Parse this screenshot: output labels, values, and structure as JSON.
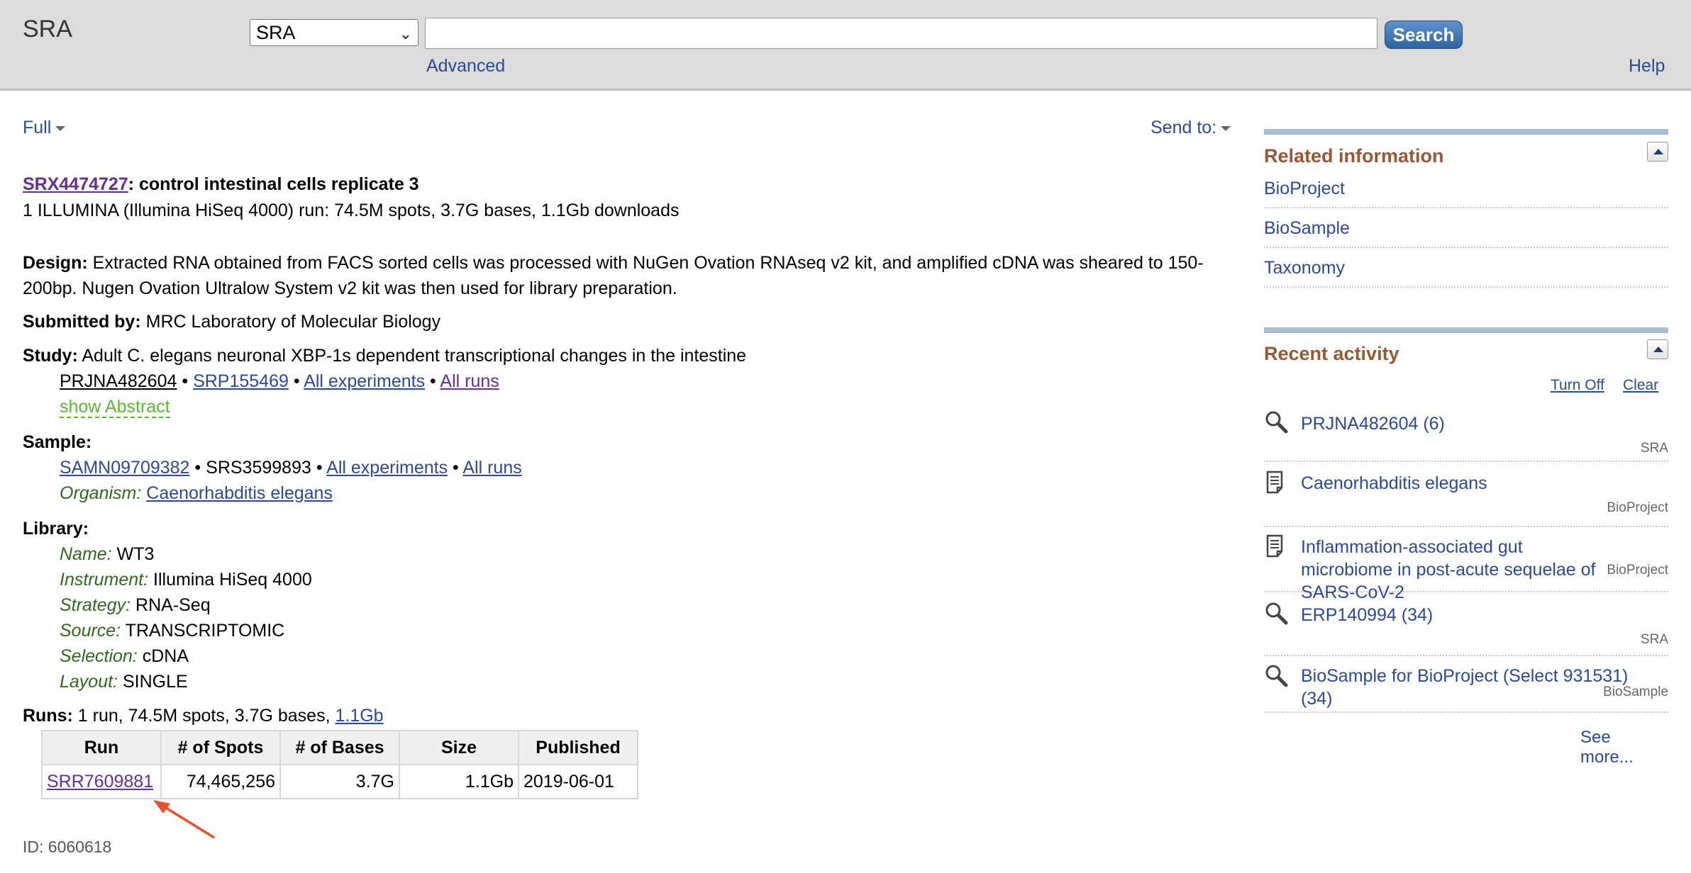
{
  "header": {
    "db_title": "SRA",
    "db_select_value": "SRA",
    "search_value": "",
    "search_label": "Search",
    "advanced": "Advanced",
    "help": "Help"
  },
  "toolbar": {
    "format": "Full",
    "send_to": "Send to:"
  },
  "record": {
    "accession": "SRX4474727",
    "title_rest": ": control intestinal cells replicate 3",
    "summary": "1 ILLUMINA (Illumina HiSeq 4000) run: 74.5M spots, 3.7G bases, 1.1Gb downloads",
    "design_label": "Design:",
    "design_text": "Extracted RNA obtained from FACS sorted cells was processed with NuGen Ovation RNAseq v2 kit, and amplified cDNA was sheared to 150-200bp. Nugen Ovation Ultralow System v2 kit was then used for library preparation.",
    "submitted_label": "Submitted by:",
    "submitted_value": "MRC Laboratory of Molecular Biology",
    "study_label": "Study:",
    "study_value": "Adult C. elegans neuronal XBP-1s dependent transcriptional changes in the intestine",
    "study_links": {
      "bioproject": "PRJNA482604",
      "srp": "SRP155469",
      "all_experiments": "All experiments",
      "all_runs": "All runs",
      "sep": "•"
    },
    "show_abstract": "show Abstract",
    "sample_label": "Sample:",
    "sample_links": {
      "biosample": "SAMN09709382",
      "srs": "SRS3599893",
      "all_experiments": "All experiments",
      "all_runs": "All runs"
    },
    "organism_label": "Organism:",
    "organism_value": "Caenorhabditis elegans",
    "library_label": "Library:",
    "library": [
      {
        "label": "Name:",
        "value": "WT3"
      },
      {
        "label": "Instrument:",
        "value": "Illumina HiSeq 4000"
      },
      {
        "label": "Strategy:",
        "value": "RNA-Seq"
      },
      {
        "label": "Source:",
        "value": "TRANSCRIPTOMIC"
      },
      {
        "label": "Selection:",
        "value": "cDNA"
      },
      {
        "label": "Layout:",
        "value": "SINGLE"
      }
    ],
    "runs_label": "Runs:",
    "runs_summary": "1 run, 74.5M spots, 3.7G bases,",
    "runs_download": "1.1Gb",
    "runs_table": {
      "headers": [
        "Run",
        "# of Spots",
        "# of Bases",
        "Size",
        "Published"
      ],
      "rows": [
        [
          "SRR7609881",
          "74,465,256",
          "3.7G",
          "1.1Gb",
          "2019-06-01"
        ]
      ]
    },
    "id_line": "ID: 6060618"
  },
  "sidebar": {
    "related_title": "Related information",
    "related": [
      "BioProject",
      "BioSample",
      "Taxonomy"
    ],
    "recent_title": "Recent activity",
    "turn_off": "Turn Off",
    "clear": "Clear",
    "activity": [
      {
        "icon": "search-icon",
        "text": "PRJNA482604 (6)",
        "db": "SRA"
      },
      {
        "icon": "document-icon",
        "text": "Caenorhabditis elegans",
        "db": "BioProject"
      },
      {
        "icon": "document-icon",
        "text": "Inflammation-associated gut microbiome in post-acute sequelae of SARS-CoV-2",
        "db": "BioProject"
      },
      {
        "icon": "search-icon",
        "text": "ERP140994 (34)",
        "db": "SRA"
      },
      {
        "icon": "search-icon",
        "text": "BioSample for BioProject (Select 931531) (34)",
        "db": "BioSample"
      }
    ],
    "see_more": "See more..."
  },
  "colors": {
    "link": "#2a4a93",
    "visited": "#6a2c91",
    "portlet_title": "#985735",
    "portlet_bar": "#a8bdd1",
    "field_label": "#2d6b1c",
    "abstract": "#5bb832",
    "annotation_arrow": "#e8502e"
  }
}
